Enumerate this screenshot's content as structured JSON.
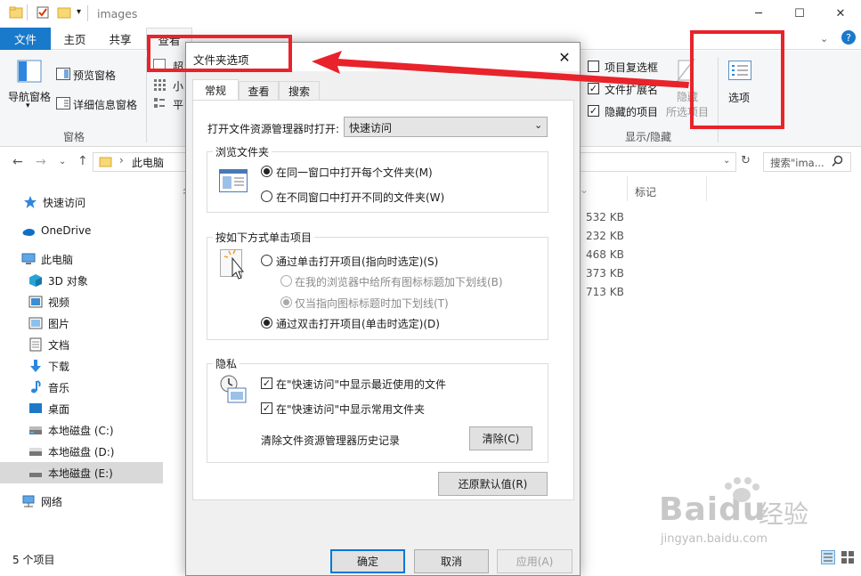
{
  "window": {
    "title": "images",
    "minimize_icon": "minimize-icon",
    "maximize_icon": "maximize-icon",
    "close_icon": "close-icon"
  },
  "ribbon_tabs": {
    "file": "文件",
    "home": "主页",
    "share": "共享",
    "view": "查看"
  },
  "ribbon": {
    "nav_pane": "导航窗格",
    "preview_pane": "预览窗格",
    "details_pane": "详细信息窗格",
    "group_pane": "窗格",
    "layout_small": "小",
    "layout_tile": "平",
    "layout_extra": "超",
    "item_checkboxes": "项目复选框",
    "file_extensions": "文件扩展名",
    "hidden_items": "隐藏的项目",
    "hide_selected_1": "隐藏",
    "hide_selected_2": "所选项目",
    "options": "选项",
    "group_show_hide": "显示/隐藏",
    "item_checkboxes_checked": false,
    "file_extensions_checked": true,
    "hidden_items_checked": true
  },
  "address": {
    "path": "此电脑",
    "search_placeholder": "搜索\"ima...",
    "prefix": "›"
  },
  "sidebar": {
    "quick_access": "快速访问",
    "onedrive": "OneDrive",
    "this_pc": "此电脑",
    "objects3d": "3D 对象",
    "videos": "视频",
    "pictures": "图片",
    "documents": "文档",
    "downloads": "下载",
    "music": "音乐",
    "desktop": "桌面",
    "disk_c": "本地磁盘 (C:)",
    "disk_d": "本地磁盘 (D:)",
    "disk_e": "本地磁盘 (E:)",
    "network": "网络"
  },
  "listing": {
    "col_tags": "标记",
    "col_name_partial": "名",
    "sizes": [
      "532 KB",
      "232 KB",
      "468 KB",
      "373 KB",
      "713 KB"
    ]
  },
  "status": {
    "count": "5 个项目"
  },
  "dialog": {
    "title": "文件夹选项",
    "tabs": {
      "general": "常规",
      "view": "查看",
      "search": "搜索"
    },
    "open_in_label": "打开文件资源管理器时打开:",
    "open_in_value": "快速访问",
    "browse": {
      "legend": "浏览文件夹",
      "same_window": "在同一窗口中打开每个文件夹(M)",
      "new_window": "在不同窗口中打开不同的文件夹(W)"
    },
    "click": {
      "legend": "按如下方式单击项目",
      "single": "通过单击打开项目(指向时选定)(S)",
      "underline_all": "在我的浏览器中给所有图标标题加下划线(B)",
      "underline_point": "仅当指向图标标题时加下划线(T)",
      "double": "通过双击打开项目(单击时选定)(D)"
    },
    "privacy": {
      "legend": "隐私",
      "recent_files": "在\"快速访问\"中显示最近使用的文件",
      "frequent_folders": "在\"快速访问\"中显示常用文件夹",
      "clear_label": "清除文件资源管理器历史记录",
      "clear_button": "清除(C)"
    },
    "restore_defaults": "还原默认值(R)",
    "ok": "确定",
    "cancel": "取消",
    "apply": "应用(A)"
  },
  "watermark": {
    "brand": "Baidu",
    "cn": "经验",
    "url": "jingyan.baidu.com"
  },
  "colors": {
    "accent": "#1979ca",
    "annotation_red": "#e8232b",
    "selection": "#d9d9d9"
  }
}
